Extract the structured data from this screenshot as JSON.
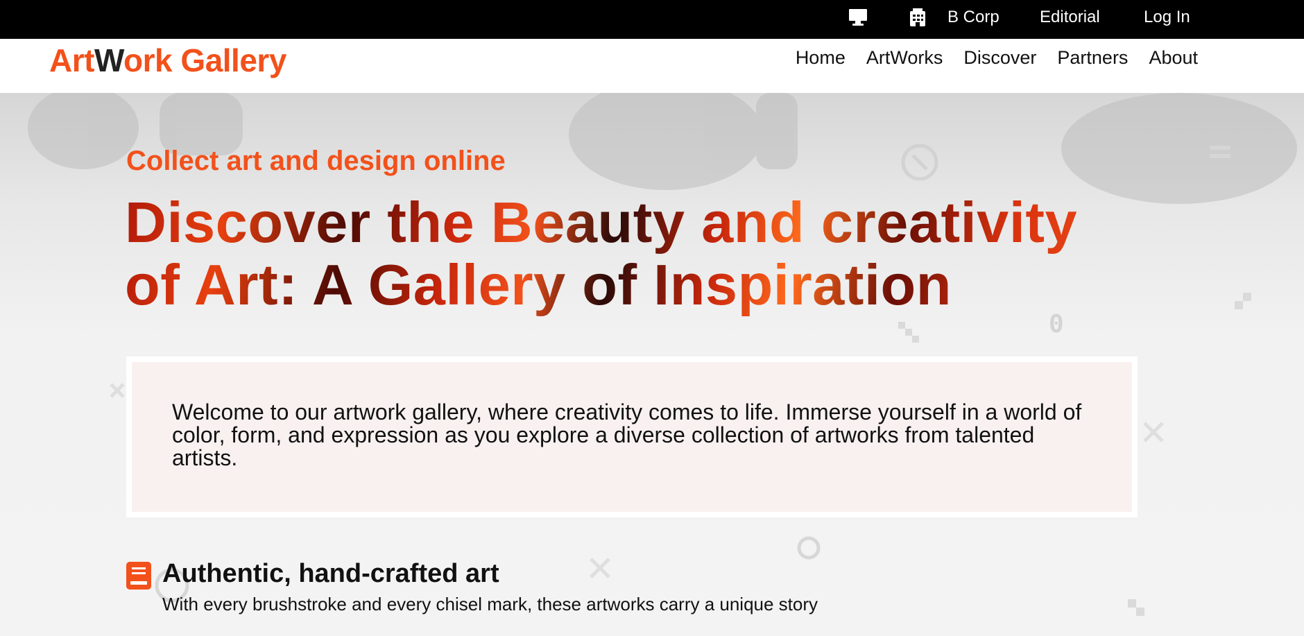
{
  "topbar": {
    "icons": [
      "desktop-icon",
      "building-icon"
    ],
    "bcorp": "B Corp",
    "editorial": "Editorial",
    "login": "Log In"
  },
  "nav": {
    "logo_part1": "Art",
    "logo_part2": "W",
    "logo_part3": "ork Gallery",
    "links": [
      "Home",
      "ArtWorks",
      "Discover",
      "Partners",
      "About"
    ]
  },
  "hero": {
    "eyebrow": "Collect art and design online",
    "headline": "Discover the Beauty and creativity of Art: A Gallery of Inspiration",
    "intro": "Welcome to our artwork gallery, where creativity comes to life. Immerse yourself in a world of color, form, and expression as you explore a diverse collection of artworks from talented artists."
  },
  "feature": {
    "icon": "book-icon",
    "title": "Authentic, hand-crafted art",
    "description": "With every brushstroke and every chisel mark, these artworks carry a unique story"
  },
  "colors": {
    "accent": "#f2511b",
    "topbar_bg": "#000000",
    "intro_bg": "#f8f1f0"
  }
}
